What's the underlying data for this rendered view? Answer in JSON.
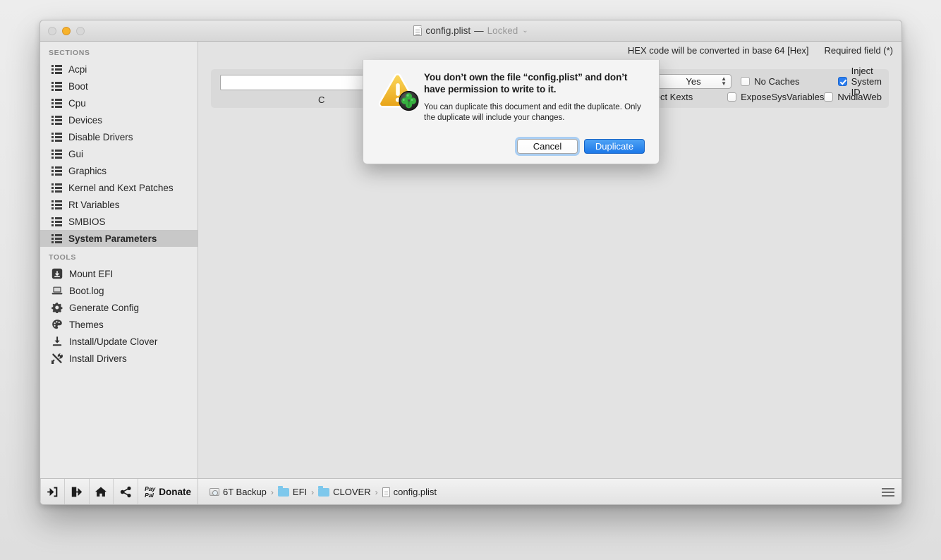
{
  "window": {
    "title_file": "config.plist",
    "title_dash": "—",
    "title_state": "Locked",
    "title_chevron": "⌄",
    "traffic": [
      "close",
      "minimize",
      "zoom"
    ]
  },
  "sidebar": {
    "sections_header": "SECTIONS",
    "sections": [
      {
        "label": "Acpi",
        "icon": "list-icon",
        "selected": false
      },
      {
        "label": "Boot",
        "icon": "list-icon",
        "selected": false
      },
      {
        "label": "Cpu",
        "icon": "list-icon",
        "selected": false
      },
      {
        "label": "Devices",
        "icon": "list-icon",
        "selected": false
      },
      {
        "label": "Disable Drivers",
        "icon": "list-icon",
        "selected": false
      },
      {
        "label": "Gui",
        "icon": "list-icon",
        "selected": false
      },
      {
        "label": "Graphics",
        "icon": "list-icon",
        "selected": false
      },
      {
        "label": "Kernel and Kext Patches",
        "icon": "list-icon",
        "selected": false
      },
      {
        "label": "Rt Variables",
        "icon": "list-icon",
        "selected": false
      },
      {
        "label": "SMBIOS",
        "icon": "list-icon",
        "selected": false
      },
      {
        "label": "System Parameters",
        "icon": "list-icon",
        "selected": true
      }
    ],
    "tools_header": "TOOLS",
    "tools": [
      {
        "label": "Mount EFI",
        "icon": "mount-efi-icon"
      },
      {
        "label": "Boot.log",
        "icon": "laptop-icon"
      },
      {
        "label": "Generate Config",
        "icon": "gear-icon"
      },
      {
        "label": "Themes",
        "icon": "palette-icon"
      },
      {
        "label": "Install/Update Clover",
        "icon": "download-icon"
      },
      {
        "label": "Install Drivers",
        "icon": "tools-icon"
      }
    ],
    "toolbar": [
      {
        "name": "import-button",
        "icon": "arrow-into-box-icon"
      },
      {
        "name": "export-button",
        "icon": "arrow-out-of-box-icon"
      },
      {
        "name": "home-button",
        "icon": "home-icon"
      },
      {
        "name": "share-button",
        "icon": "share-icon"
      }
    ],
    "donate": {
      "brand_line1": "Pay",
      "brand_line2": "Pal",
      "label": "Donate"
    }
  },
  "content": {
    "hints": [
      "HEX code will be converted in base 64 [Hex]",
      "Required field (*)"
    ],
    "input": {
      "value": "",
      "placeholder": ""
    },
    "clipped_label": "C",
    "popup": {
      "value": "Yes",
      "label": "Inject Kexts"
    },
    "checkboxes": [
      {
        "label": "No Caches",
        "checked": false
      },
      {
        "label": "Inject System ID",
        "checked": true
      },
      {
        "label": "ExposeSysVariables",
        "checked": false
      },
      {
        "label": "NvidiaWeb",
        "checked": false
      }
    ]
  },
  "pathbar": {
    "crumbs": [
      {
        "label": "6T Backup",
        "icon": "disk-icon"
      },
      {
        "label": "EFI",
        "icon": "folder-icon"
      },
      {
        "label": "CLOVER",
        "icon": "folder-icon"
      },
      {
        "label": "config.plist",
        "icon": "file-icon"
      }
    ],
    "separator": "›",
    "menu_icon": "hamburger-icon"
  },
  "sheet": {
    "icon": "warning-clover-icon",
    "title": "You don’t own the file “config.plist” and don’t have permission to write to it.",
    "message": "You can duplicate this document and edit the duplicate. Only the duplicate will include your changes.",
    "cancel_label": "Cancel",
    "duplicate_label": "Duplicate"
  },
  "colors": {
    "accent_blue": "#2b7ef0",
    "default_button": "#1c78e8",
    "warning_yellow": "#f0b429",
    "clover_green": "#2e9e3a",
    "selected_row": "#c8c8c8"
  }
}
